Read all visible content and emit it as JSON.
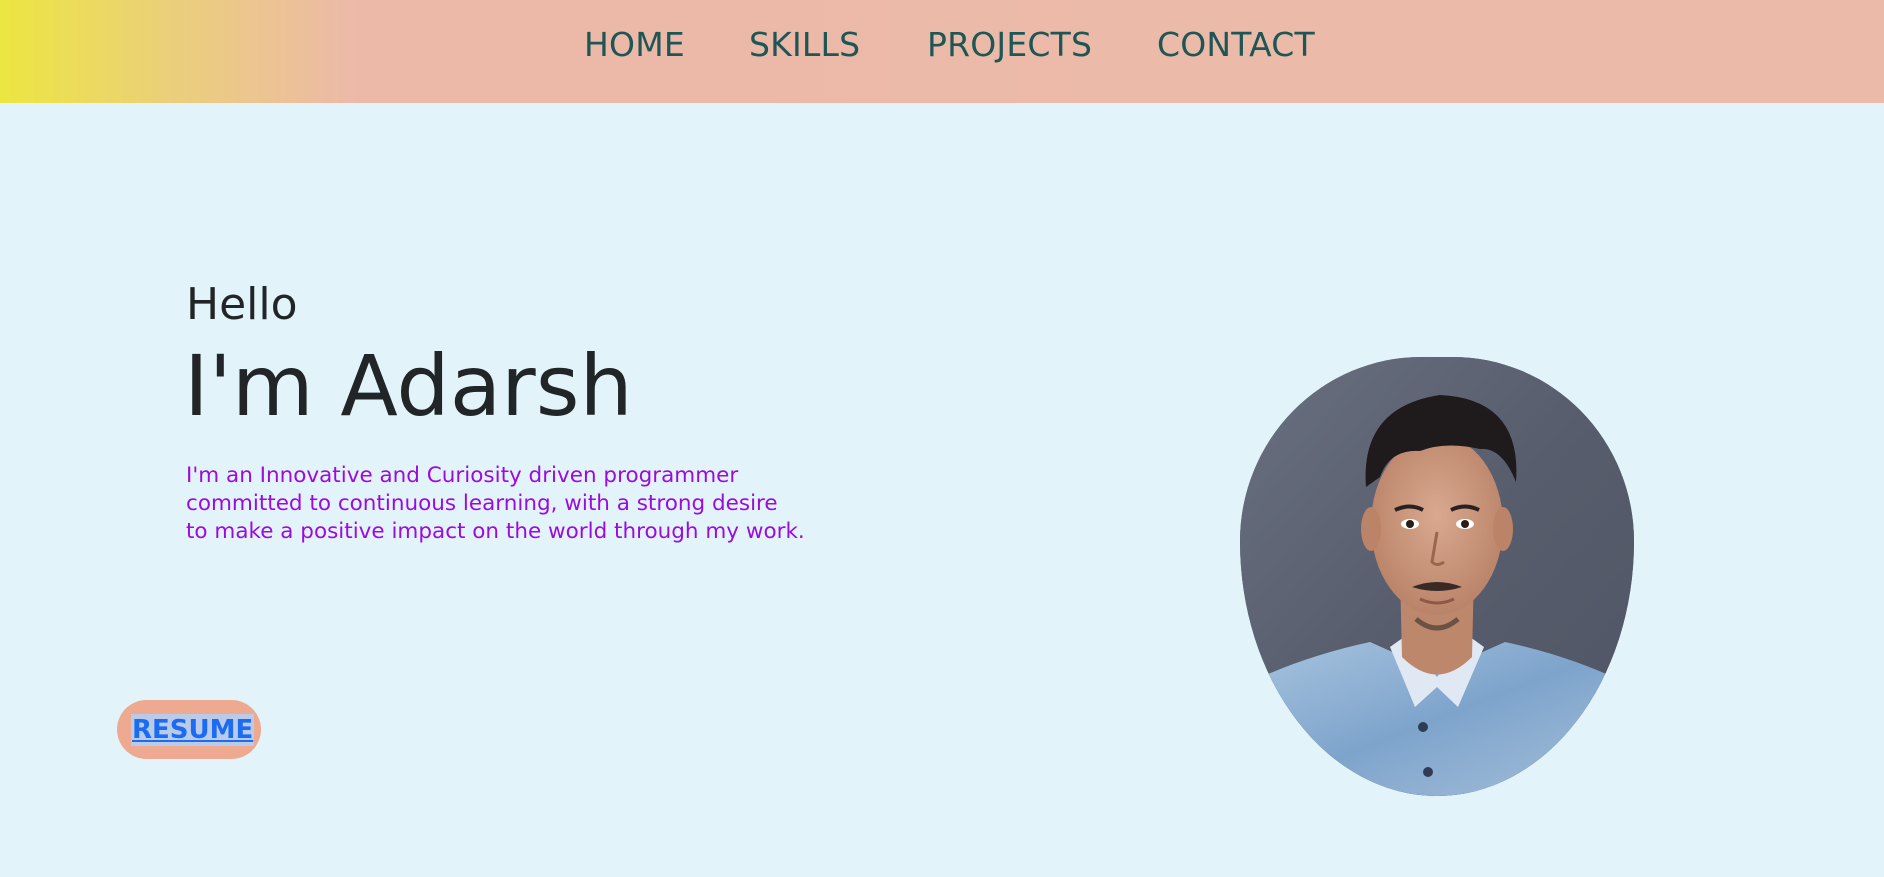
{
  "nav": {
    "items": [
      {
        "label": "HOME"
      },
      {
        "label": "SKILLS"
      },
      {
        "label": "PROJECTS"
      },
      {
        "label": "CONTACT"
      }
    ]
  },
  "hero": {
    "greeting": "Hello",
    "name": "I'm Adarsh",
    "intro": "I'm an Innovative and Curiosity driven programmer committed to continuous learning, with a strong desire to make a positive impact on the world through my work.",
    "resume_label": "RESUME"
  },
  "colors": {
    "page_background": "#e2f4fa",
    "navbar_background": "#ecbaa9",
    "navbar_gradient_start": "#ece640",
    "nav_text": "#1e5655",
    "heading_text": "#212528",
    "intro_text": "#9b0bdf",
    "resume_button_background": "#eeaa90",
    "resume_link": "#1b6bf3"
  },
  "profile_photo": {
    "description_icon": "profile-photo"
  }
}
